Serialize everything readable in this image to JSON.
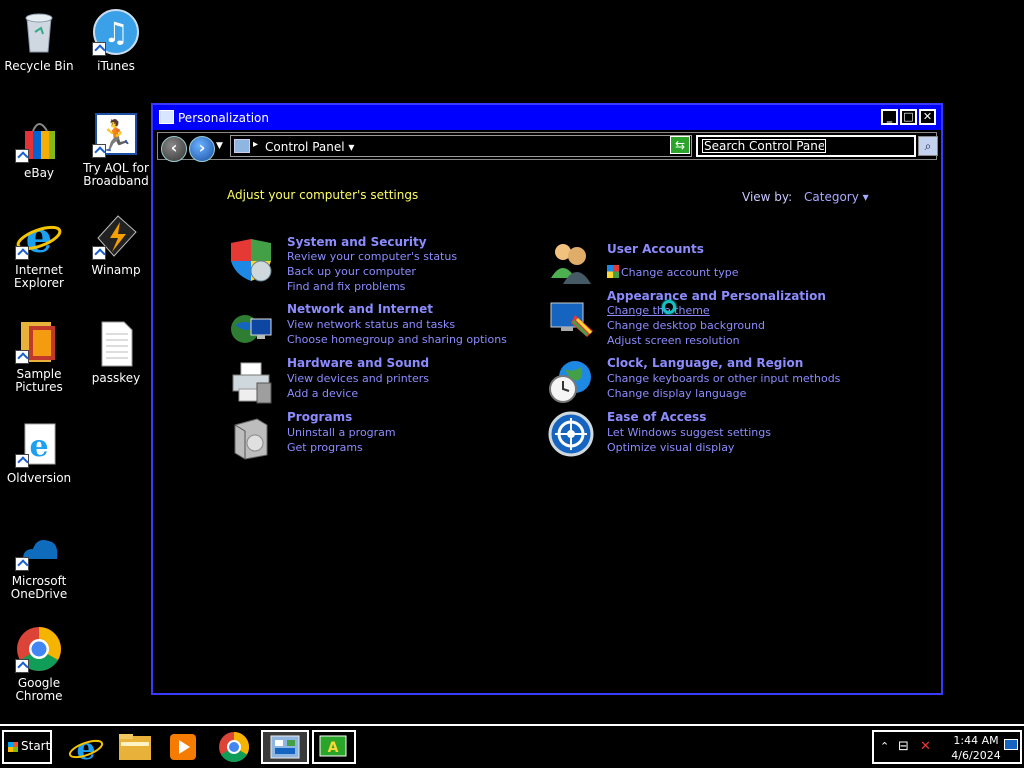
{
  "desktop": {
    "icons": [
      {
        "label": "Recycle Bin"
      },
      {
        "label": "iTunes"
      },
      {
        "label": "eBay"
      },
      {
        "label": "Try AOL for Broadband"
      },
      {
        "label": "Internet Explorer"
      },
      {
        "label": "Winamp"
      },
      {
        "label": "Sample Pictures"
      },
      {
        "label": "passkey"
      },
      {
        "label": "Oldversion"
      },
      {
        "label": "Microsoft OneDrive"
      },
      {
        "label": "Google Chrome"
      }
    ]
  },
  "window": {
    "title": "Personalization",
    "address": {
      "crumb": "Control Panel"
    },
    "search": {
      "placeholder": "Search Control Panel"
    },
    "heading": "Adjust your computer's settings",
    "view_by": {
      "label": "View by:",
      "value": "Category"
    },
    "categories": [
      {
        "title": "System and Security",
        "links": [
          "Review your computer's status",
          "Back up your computer",
          "Find and fix problems"
        ]
      },
      {
        "title": "Network and Internet",
        "links": [
          "View network status and tasks",
          "Choose homegroup and sharing options"
        ]
      },
      {
        "title": "Hardware and Sound",
        "links": [
          "View devices and printers",
          "Add a device"
        ]
      },
      {
        "title": "Programs",
        "links": [
          "Uninstall a program",
          "Get programs"
        ]
      },
      {
        "title": "User Accounts",
        "links": [
          "Change account type"
        ]
      },
      {
        "title": "Appearance and Personalization",
        "links": [
          "Change the theme",
          "Change desktop background",
          "Adjust screen resolution"
        ]
      },
      {
        "title": "Clock, Language, and Region",
        "links": [
          "Change keyboards or other input methods",
          "Change display language"
        ]
      },
      {
        "title": "Ease of Access",
        "links": [
          "Let Windows suggest settings",
          "Optimize visual display"
        ]
      }
    ]
  },
  "taskbar": {
    "start_label": "Start",
    "clock": {
      "time": "1:44 AM",
      "date": "4/6/2024"
    }
  }
}
